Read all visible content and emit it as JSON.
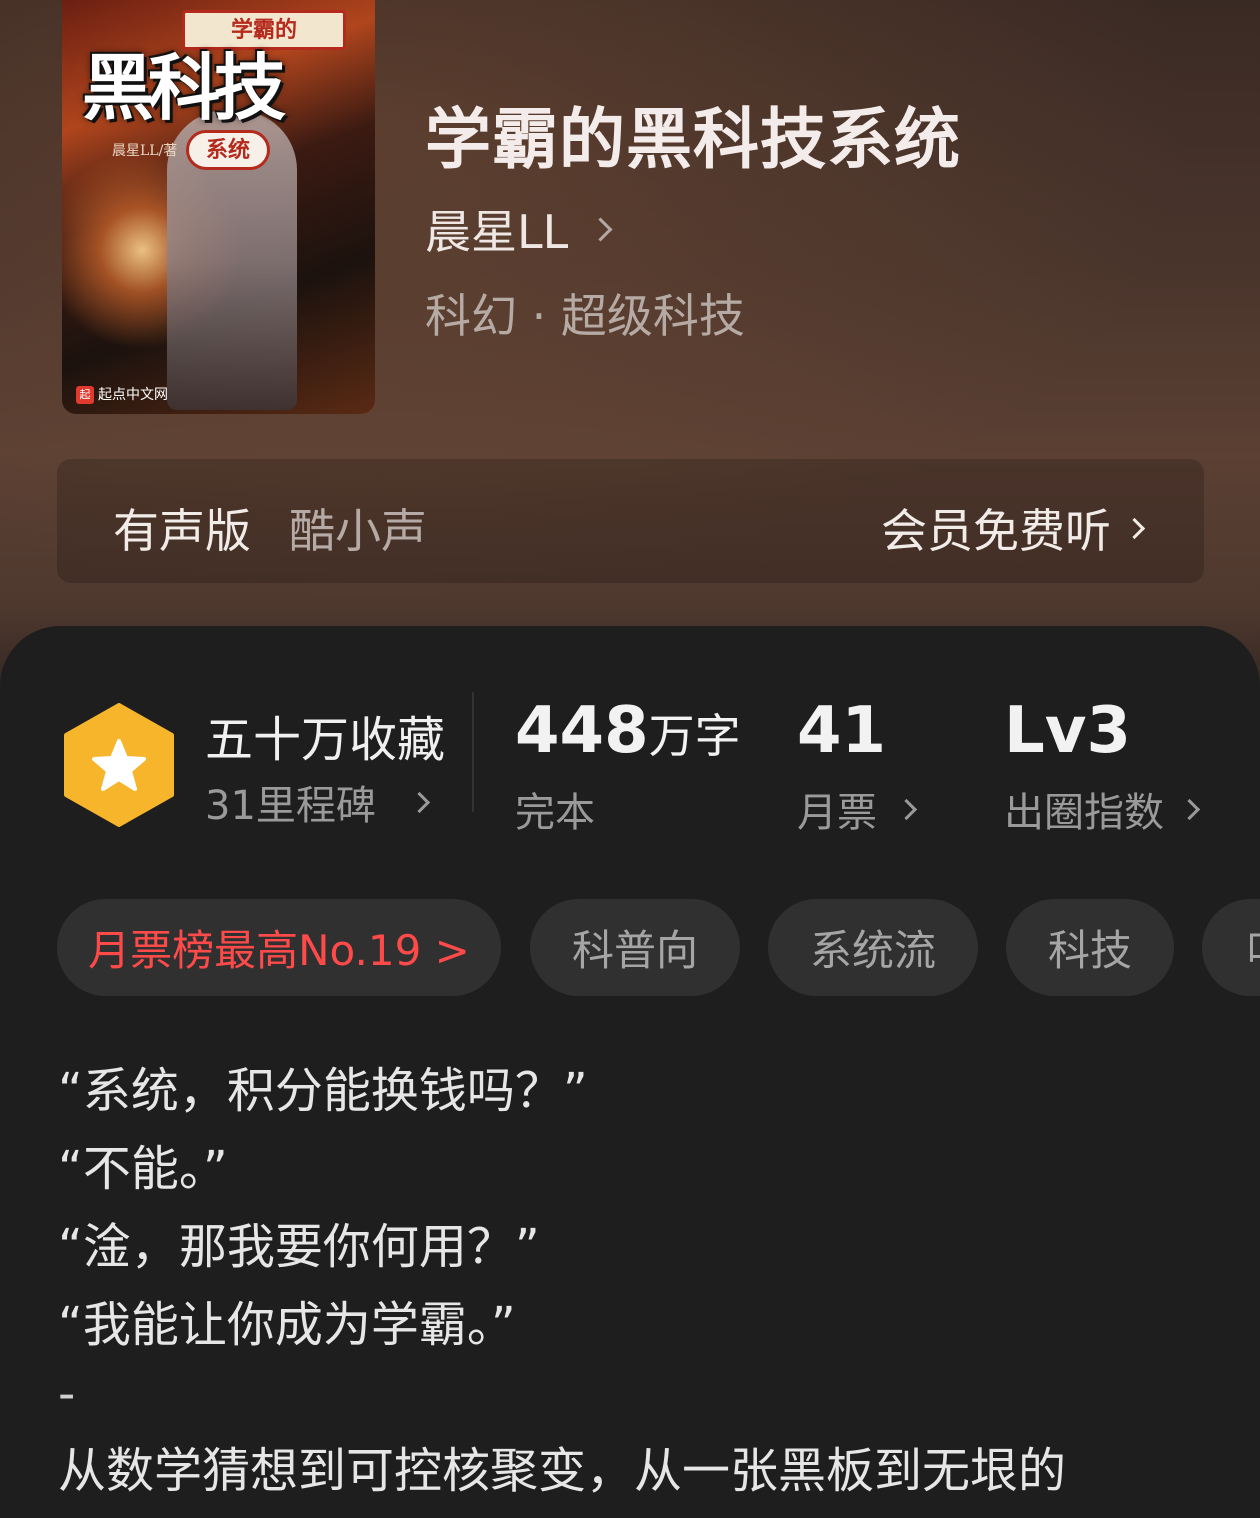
{
  "book": {
    "title": "学霸的黑科技系统",
    "author": "晨星LL",
    "genre": "科幻 · 超级科技",
    "cover": {
      "top_badge": "学霸的",
      "big_title": "黑科技",
      "sub_badge": "系统",
      "author_tag": "晨星LL/著",
      "publisher": "起点中文网",
      "publisher_logo": "起"
    }
  },
  "audio": {
    "label": "有声版",
    "source": "酷小声",
    "cta": "会员免费听"
  },
  "stats": {
    "collection": {
      "main": "五十万收藏",
      "sub": "31里程碑",
      "icon": "star-hexagon-icon",
      "icon_color": "#f7b52c"
    },
    "words": {
      "number": "448",
      "unit": "万字",
      "label": "完本"
    },
    "monthly_ticket": {
      "value": "41",
      "label": "月票"
    },
    "influence": {
      "value": "Lv3",
      "label": "出圈指数"
    }
  },
  "tags": [
    {
      "label": "月票榜最高No.19 >"
    },
    {
      "label": "科普向"
    },
    {
      "label": "系统流"
    },
    {
      "label": "科技"
    },
    {
      "label": "叫"
    }
  ],
  "intro": {
    "lines": [
      "“系统，积分能换钱吗？”",
      "“不能。”",
      "“淦，那我要你何用？”",
      "“我能让你成为学霸。”"
    ],
    "separator": "-",
    "paragraph": "从数学猜想到可控核聚变，从一张黑板到无垠的"
  },
  "colors": {
    "accent_red": "#ff4a4a",
    "sheet_bg": "#1e1e1f",
    "tag_bg": "#303031"
  }
}
